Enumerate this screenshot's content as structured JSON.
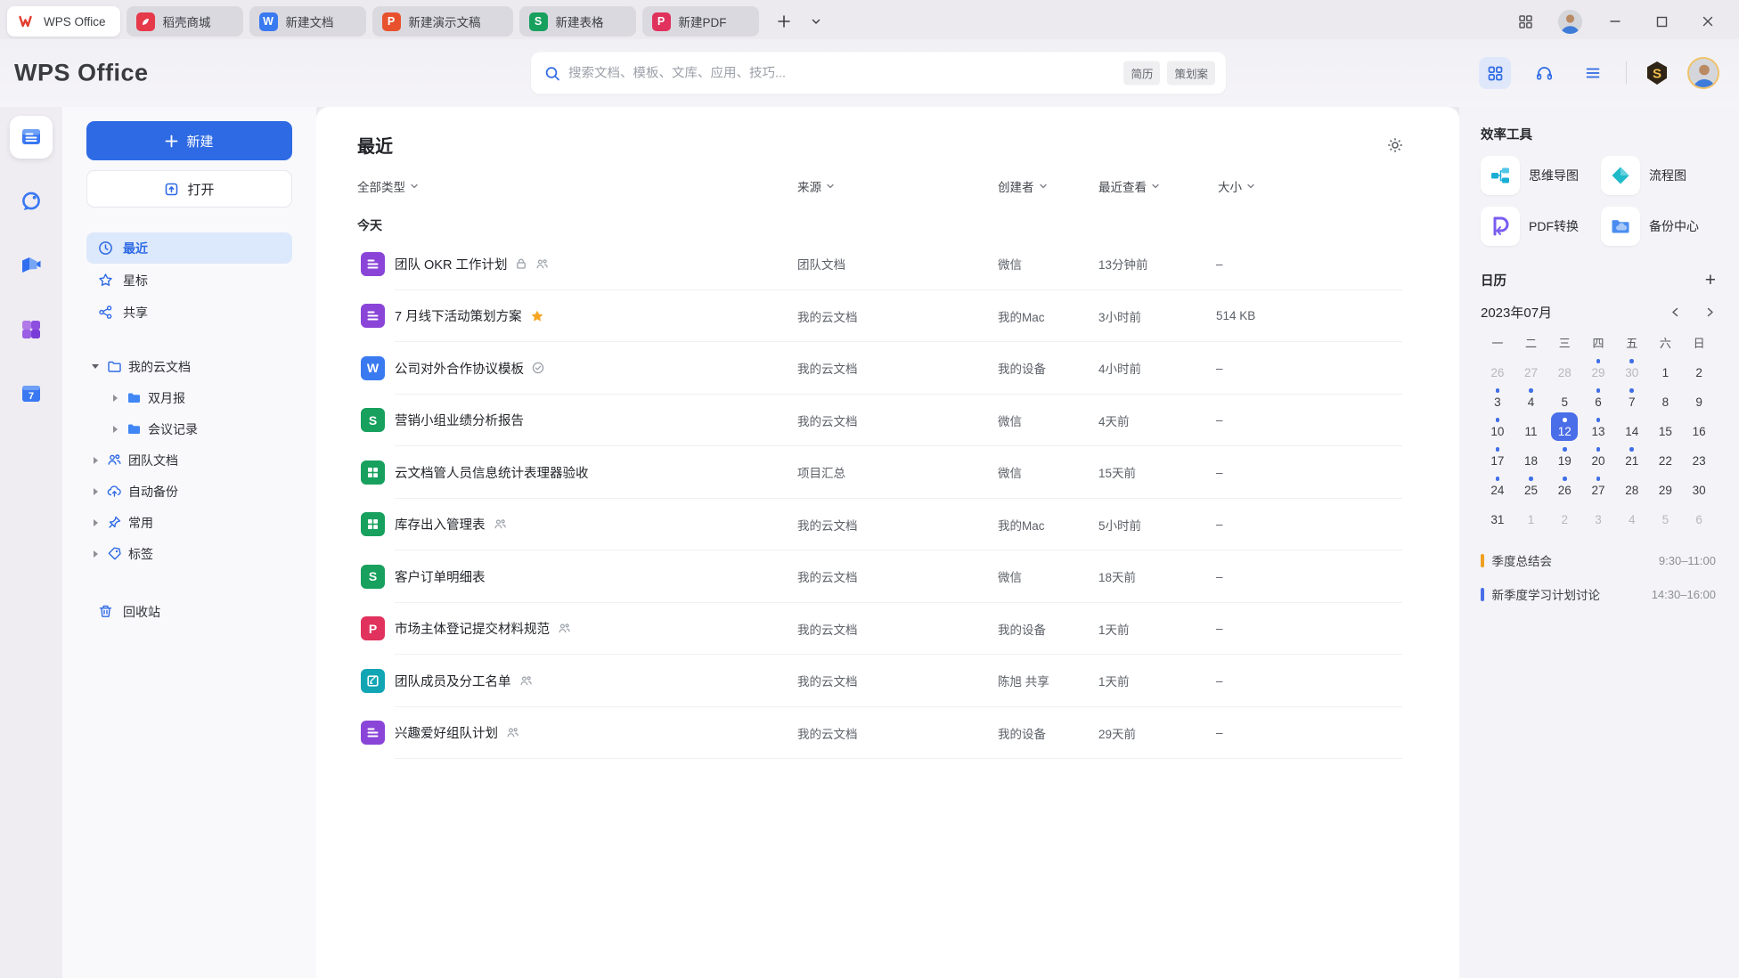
{
  "palette": {
    "accent_blue": "#2e6ae4",
    "selected_day_blue": "#4a6de8",
    "dot_blue": "#3f6fe8",
    "star_gold": "#f5a623",
    "event_orange": "#f0a020",
    "event_blue": "#4a6fe8"
  },
  "tabbar": {
    "tabs": [
      {
        "id": "wps-home",
        "label": "WPS Office",
        "icon": "wps-w-icon",
        "glyph": "",
        "color": "",
        "active": true
      },
      {
        "id": "docer-store",
        "label": "稻壳商城",
        "icon": "docer-icon",
        "glyph": "",
        "color": "#e6394a",
        "active": false
      },
      {
        "id": "new-doc",
        "label": "新建文档",
        "icon": "doc-icon",
        "glyph": "W",
        "color": "#3a7af0",
        "active": false
      },
      {
        "id": "new-ppt",
        "label": "新建演示文稿",
        "icon": "ppt-icon",
        "glyph": "P",
        "color": "#e8512e",
        "active": false
      },
      {
        "id": "new-sheet",
        "label": "新建表格",
        "icon": "sheet-icon",
        "glyph": "S",
        "color": "#17a05e",
        "active": false
      },
      {
        "id": "new-pdf",
        "label": "新建PDF",
        "icon": "pdf-icon",
        "glyph": "P",
        "color": "#e0325c",
        "active": false
      }
    ],
    "new_tab_icon": "plus-icon",
    "tab_menu_icon": "chevron-down-icon",
    "right_icons": [
      "apps-grid-icon",
      "avatar",
      "minimize-icon",
      "maximize-icon",
      "close-icon"
    ]
  },
  "header": {
    "logo": "WPS Office",
    "search": {
      "placeholder": "搜索文档、模板、文库、应用、技巧...",
      "icon": "search-icon",
      "tags": [
        "简历",
        "策划案"
      ]
    },
    "right_icons": [
      "apps-grid-icon",
      "headset-icon",
      "menu-icon",
      "svip-badge-icon",
      "avatar"
    ]
  },
  "rail": {
    "items": [
      {
        "id": "documents",
        "icon": "docs-rail-icon",
        "active": true
      },
      {
        "id": "messages",
        "icon": "chat-rail-icon",
        "active": false
      },
      {
        "id": "meetings",
        "icon": "video-rail-icon",
        "active": false
      },
      {
        "id": "apps",
        "icon": "apps-rail-icon",
        "active": false
      },
      {
        "id": "calendar",
        "icon": "calendar-rail-icon",
        "active": false
      }
    ]
  },
  "sidebar": {
    "new_button": "新建",
    "open_button": "打开",
    "items": [
      {
        "id": "recent",
        "label": "最近",
        "icon": "clock-icon",
        "active": true
      },
      {
        "id": "starred",
        "label": "星标",
        "icon": "star-icon",
        "active": false
      },
      {
        "id": "shared",
        "label": "共享",
        "icon": "share-icon",
        "active": false
      }
    ],
    "tree": [
      {
        "id": "my-cloud-docs",
        "label": "我的云文档",
        "icon": "folder-outline-icon",
        "arrow": "down",
        "level": 0
      },
      {
        "id": "bimonthly-report",
        "label": "双月报",
        "icon": "folder-blue-icon",
        "arrow": "right",
        "level": 1
      },
      {
        "id": "meeting-notes",
        "label": "会议记录",
        "icon": "folder-blue-icon",
        "arrow": "right",
        "level": 1
      },
      {
        "id": "team-docs",
        "label": "团队文档",
        "icon": "team-icon",
        "arrow": "right",
        "level": 0
      },
      {
        "id": "auto-backup",
        "label": "自动备份",
        "icon": "cloud-upload-icon",
        "arrow": "right",
        "level": 0
      },
      {
        "id": "frequent",
        "label": "常用",
        "icon": "pin-icon",
        "arrow": "right",
        "level": 0
      },
      {
        "id": "tags",
        "label": "标签",
        "icon": "tag-icon",
        "arrow": "right",
        "level": 0
      }
    ],
    "trash": {
      "id": "trash",
      "label": "回收站",
      "icon": "trash-icon"
    }
  },
  "main": {
    "title": "最近",
    "settings_icon": "gear-icon",
    "filters": [
      {
        "id": "type",
        "label": "全部类型"
      },
      {
        "id": "source",
        "label": "来源"
      },
      {
        "id": "creator",
        "label": "创建者"
      },
      {
        "id": "viewed",
        "label": "最近查看"
      },
      {
        "id": "size",
        "label": "大小"
      }
    ],
    "group_label": "今天",
    "files": [
      {
        "name": "团队 OKR 工作计划",
        "icon": "purple-doc",
        "color": "#8a45d8",
        "badges": [
          "lock-icon",
          "members-icon"
        ],
        "source": "团队文档",
        "creator": "微信",
        "viewed": "13分钟前",
        "size": "–"
      },
      {
        "name": "7 月线下活动策划方案",
        "icon": "purple-doc",
        "color": "#8a45d8",
        "badges": [
          "star-fill-icon"
        ],
        "source": "我的云文档",
        "creator": "我的Mac",
        "viewed": "3小时前",
        "size": "514 KB"
      },
      {
        "name": "公司对外合作协议模板",
        "icon": "word",
        "color": "#3a7af0",
        "badges": [
          "check-circle-icon"
        ],
        "source": "我的云文档",
        "creator": "我的设备",
        "viewed": "4小时前",
        "size": "–"
      },
      {
        "name": "营销小组业绩分析报告",
        "icon": "sheet-s",
        "color": "#17a05e",
        "badges": [],
        "source": "我的云文档",
        "creator": "微信",
        "viewed": "4天前",
        "size": "–"
      },
      {
        "name": "云文档管人员信息统计表理器验收",
        "icon": "sheet-grid",
        "color": "#17a05e",
        "badges": [],
        "source": "项目汇总",
        "creator": "微信",
        "viewed": "15天前",
        "size": "–"
      },
      {
        "name": "库存出入管理表",
        "icon": "sheet-grid",
        "color": "#17a05e",
        "badges": [
          "members-icon"
        ],
        "source": "我的云文档",
        "creator": "我的Mac",
        "viewed": "5小时前",
        "size": "–"
      },
      {
        "name": "客户订单明细表",
        "icon": "sheet-s",
        "color": "#17a05e",
        "badges": [],
        "source": "我的云文档",
        "creator": "微信",
        "viewed": "18天前",
        "size": "–"
      },
      {
        "name": "市场主体登记提交材料规范",
        "icon": "pdf",
        "color": "#e0325c",
        "badges": [
          "members-icon"
        ],
        "source": "我的云文档",
        "creator": "我的设备",
        "viewed": "1天前",
        "size": "–"
      },
      {
        "name": "团队成员及分工名单",
        "icon": "form",
        "color": "#12a5b4",
        "badges": [
          "members-icon"
        ],
        "source": "我的云文档",
        "creator": "陈旭 共享",
        "viewed": "1天前",
        "size": "–"
      },
      {
        "name": "兴趣爱好组队计划",
        "icon": "purple-doc",
        "color": "#8a45d8",
        "badges": [
          "members-icon"
        ],
        "source": "我的云文档",
        "creator": "我的设备",
        "viewed": "29天前",
        "size": "–"
      }
    ]
  },
  "right": {
    "tools_title": "效率工具",
    "tools": [
      {
        "id": "mindmap",
        "label": "思维导图",
        "icon": "mindmap-icon"
      },
      {
        "id": "flowchart",
        "label": "流程图",
        "icon": "flowchart-icon"
      },
      {
        "id": "pdf-convert",
        "label": "PDF转换",
        "icon": "pdf-convert-icon"
      },
      {
        "id": "backup-center",
        "label": "备份中心",
        "icon": "backup-icon"
      }
    ],
    "calendar": {
      "title": "日历",
      "add_icon": "plus-icon",
      "month": "2023年07月",
      "prev_icon": "chevron-left-icon",
      "next_icon": "chevron-right-icon",
      "weekdays": [
        "一",
        "二",
        "三",
        "四",
        "五",
        "六",
        "日"
      ],
      "weeks": [
        [
          {
            "d": 26,
            "muted": true
          },
          {
            "d": 27,
            "muted": true
          },
          {
            "d": 28,
            "muted": true
          },
          {
            "d": 29,
            "muted": true,
            "dot": true
          },
          {
            "d": 30,
            "muted": true,
            "dot": true
          },
          {
            "d": 1
          },
          {
            "d": 2
          }
        ],
        [
          {
            "d": 3,
            "dot": true
          },
          {
            "d": 4,
            "dot": true
          },
          {
            "d": 5
          },
          {
            "d": 6,
            "dot": true
          },
          {
            "d": 7,
            "dot": true
          },
          {
            "d": 8
          },
          {
            "d": 9
          }
        ],
        [
          {
            "d": 10,
            "dot": true
          },
          {
            "d": 11
          },
          {
            "d": 12,
            "dot": true,
            "selected": true
          },
          {
            "d": 13,
            "dot": true
          },
          {
            "d": 14
          },
          {
            "d": 15
          },
          {
            "d": 16
          }
        ],
        [
          {
            "d": 17,
            "dot": true
          },
          {
            "d": 18
          },
          {
            "d": 19,
            "dot": true
          },
          {
            "d": 20,
            "dot": true
          },
          {
            "d": 21,
            "dot": true
          },
          {
            "d": 22
          },
          {
            "d": 23
          }
        ],
        [
          {
            "d": 24,
            "dot": true
          },
          {
            "d": 25,
            "dot": true
          },
          {
            "d": 26,
            "dot": true
          },
          {
            "d": 27,
            "dot": true
          },
          {
            "d": 28
          },
          {
            "d": 29
          },
          {
            "d": 30
          }
        ],
        [
          {
            "d": 31
          },
          {
            "d": 1,
            "muted": true
          },
          {
            "d": 2,
            "muted": true
          },
          {
            "d": 3,
            "muted": true
          },
          {
            "d": 4,
            "muted": true
          },
          {
            "d": 5,
            "muted": true
          },
          {
            "d": 6,
            "muted": true
          }
        ]
      ],
      "events": [
        {
          "name": "季度总结会",
          "time": "9:30–11:00",
          "color": "#f0a020"
        },
        {
          "name": "新季度学习计划讨论",
          "time": "14:30–16:00",
          "color": "#4a6fe8"
        }
      ]
    }
  }
}
